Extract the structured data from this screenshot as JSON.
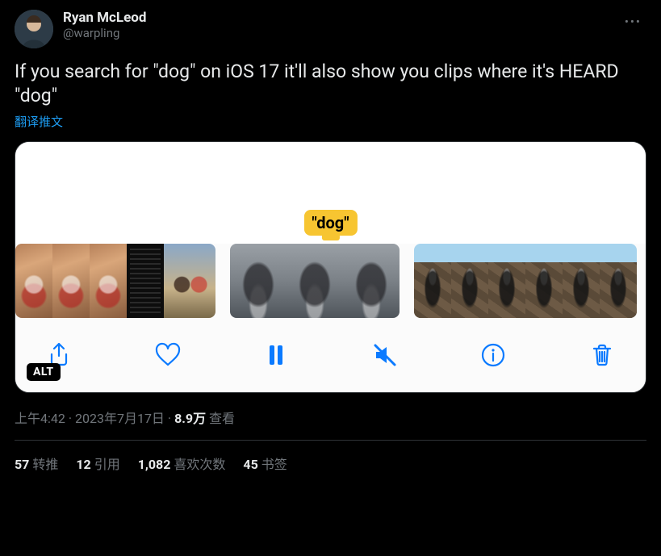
{
  "author": {
    "display_name": "Ryan McLeod",
    "handle": "@warpling"
  },
  "tweet_text": "If you search for \"dog\" on iOS 17 it'll also show you clips where it's HEARD \"dog\"",
  "translate_label": "翻译推文",
  "media": {
    "tooltip": "\"dog\"",
    "alt_badge": "ALT",
    "toolbar": {
      "share": "share",
      "like": "like",
      "pause": "pause",
      "mute": "mute",
      "info": "info",
      "trash": "trash"
    }
  },
  "meta": {
    "time": "上午4:42",
    "date": "2023年7月17日",
    "separator": " · ",
    "views_num": "8.9万",
    "views_label": " 查看"
  },
  "stats": {
    "retweets_num": "57",
    "retweets_label": "转推",
    "quotes_num": "12",
    "quotes_label": "引用",
    "likes_num": "1,082",
    "likes_label": "喜欢次数",
    "bookmarks_num": "45",
    "bookmarks_label": "书签"
  },
  "more_label": "•••"
}
